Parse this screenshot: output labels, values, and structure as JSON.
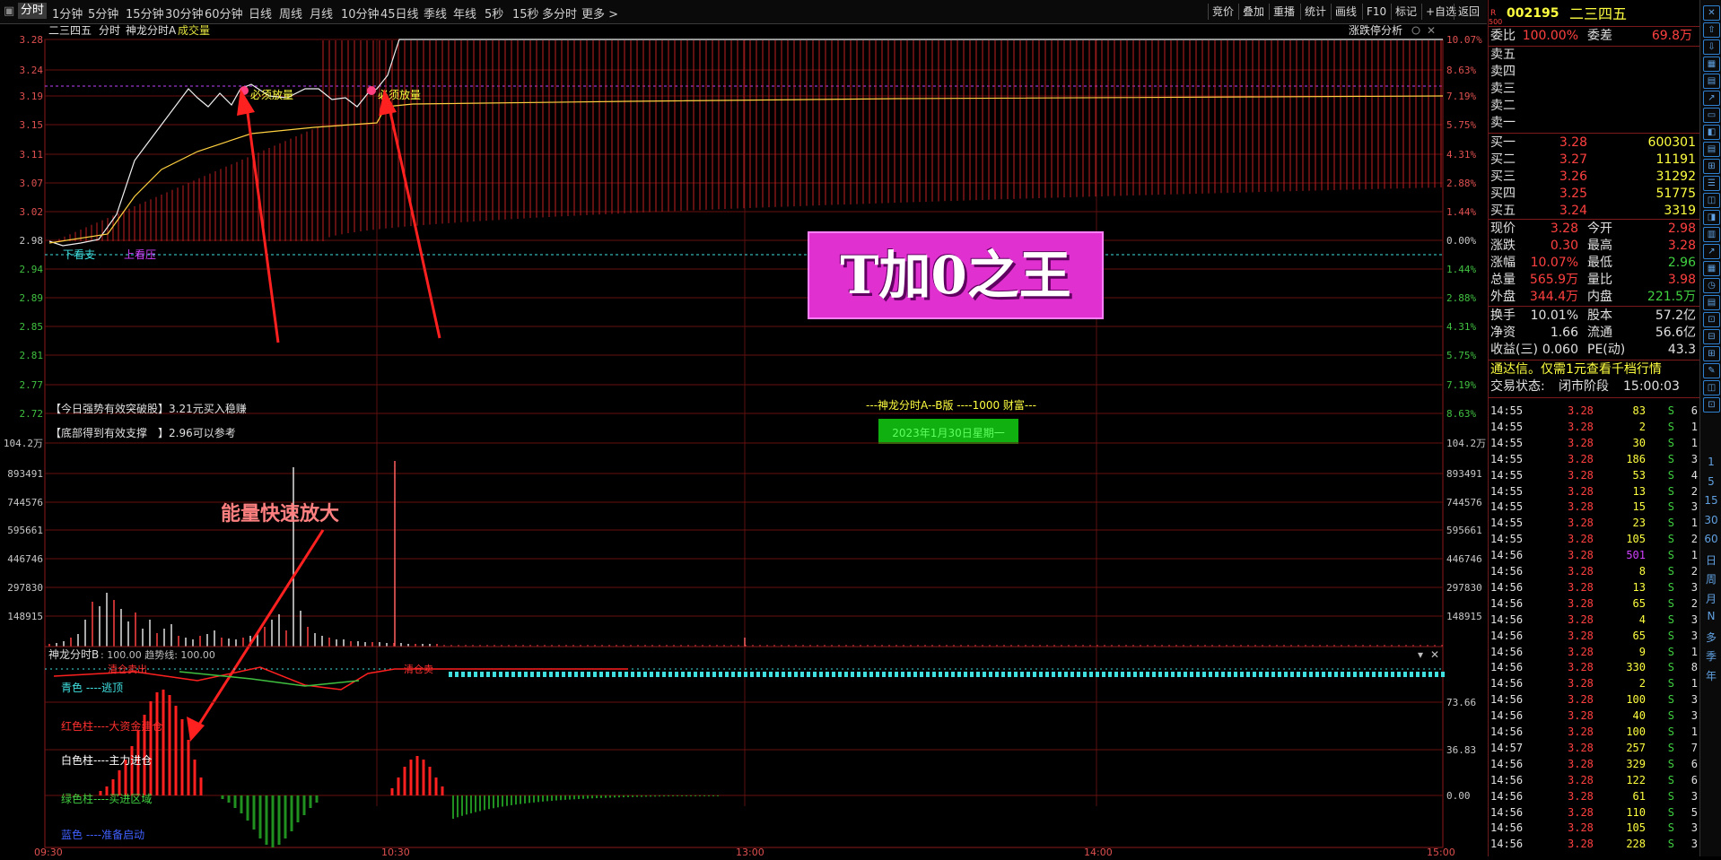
{
  "toolbar": {
    "tabs": [
      "分时",
      "1分钟",
      "5分钟",
      "15分钟",
      "30分钟",
      "60分钟",
      "日线",
      "周线",
      "月线",
      "10分钟",
      "45日线",
      "季线",
      "年线",
      "5秒",
      "15秒",
      "多分时",
      "更多 >"
    ],
    "right_buttons": [
      "竞价",
      "叠加",
      "重播",
      "统计",
      "画线",
      "F10",
      "标记",
      "+自选",
      "返回"
    ]
  },
  "chart": {
    "title_stock": "二三四五",
    "title_period": "分时",
    "title_indicator": "神龙分时A",
    "title_volume": "成交量",
    "analysis_button": "涨跌停分析",
    "price_ticks": [
      "3.28",
      "3.24",
      "3.19",
      "3.15",
      "3.11",
      "3.07",
      "3.02",
      "2.98",
      "2.94",
      "2.89",
      "2.85",
      "2.81",
      "2.77",
      "2.72"
    ],
    "pct_ticks": [
      "10.07%",
      "8.63%",
      "7.19%",
      "5.75%",
      "4.31%",
      "2.88%",
      "1.44%",
      "0.00%",
      "1.44%",
      "2.88%",
      "4.31%",
      "5.75%",
      "7.19%",
      "8.63%"
    ],
    "volume_ticks": [
      "104.2万",
      "893491",
      "744576",
      "595661",
      "446746",
      "297830",
      "148915"
    ],
    "signal_1": "必须放量",
    "signal_2": "必须放量",
    "label_lower_1": "下看支",
    "label_lower_2": "上看压",
    "note_1": "【今日强势有效突破股】3.21元买入稳赚",
    "note_2": "【底部得到有效支撑　】2.96可以参考",
    "center_title": "---神龙分时A--B版 ----1000 财富---",
    "green_box_text": "2023年1月30日星期一",
    "banner": "T加0之王",
    "annotation": "能量快速放大",
    "sub_title": "神龙分时B",
    "sub_values": ": 100.00  趋势线: 100.00",
    "sub_ticks": [
      "73.66",
      "36.83",
      "0.00"
    ],
    "legend": [
      {
        "text": "青色 ----逃顶",
        "color": "#40e0e0"
      },
      {
        "text": "红色柱----大资金建仓",
        "color": "#ff3030"
      },
      {
        "text": "白色柱----主力进仓",
        "color": "#ffffff"
      },
      {
        "text": "绿色柱----买进区域",
        "color": "#40d040"
      },
      {
        "text": "蓝色 ----准备启动",
        "color": "#4060ff"
      }
    ],
    "sub_marks": [
      "清仓卖出",
      "清仓卖"
    ],
    "time_axis": [
      "09:30",
      "10:30",
      "13:00",
      "14:00",
      "15:00"
    ]
  },
  "quote": {
    "code": "002195",
    "name": "二三四五",
    "r_label": "R",
    "r_sub": "500",
    "weibi_label": "委比",
    "weibi": "100.00%",
    "weicha_label": "委差",
    "weicha": "69.8万",
    "sells": [
      "卖五",
      "卖四",
      "卖三",
      "卖二",
      "卖一"
    ],
    "buys": [
      {
        "label": "买一",
        "price": "3.28",
        "vol": "600301"
      },
      {
        "label": "买二",
        "price": "3.27",
        "vol": "11191"
      },
      {
        "label": "买三",
        "price": "3.26",
        "vol": "31292"
      },
      {
        "label": "买四",
        "price": "3.25",
        "vol": "51775"
      },
      {
        "label": "买五",
        "price": "3.24",
        "vol": "3319"
      }
    ],
    "stats": [
      [
        "现价",
        "3.28",
        "今开",
        "2.98"
      ],
      [
        "涨跌",
        "0.30",
        "最高",
        "3.28"
      ],
      [
        "涨幅",
        "10.07%",
        "最低",
        "2.96"
      ],
      [
        "总量",
        "565.9万",
        "量比",
        "3.98"
      ],
      [
        "外盘",
        "344.4万",
        "内盘",
        "221.5万"
      ]
    ],
    "stats2": [
      [
        "换手",
        "10.01%",
        "股本",
        "57.2亿"
      ],
      [
        "净资",
        "1.66",
        "流通",
        "56.6亿"
      ],
      [
        "收益(三)",
        "0.060",
        "PE(动)",
        "43.3"
      ]
    ],
    "promo": "通达信。仅需1元查看千档行情",
    "status_label": "交易状态:",
    "status": "闭市阶段",
    "status_time": "15:00:03",
    "ticks": [
      [
        "14:55",
        "3.28",
        "83",
        "S",
        "6"
      ],
      [
        "14:55",
        "3.28",
        "2",
        "S",
        "1"
      ],
      [
        "14:55",
        "3.28",
        "30",
        "S",
        "1"
      ],
      [
        "14:55",
        "3.28",
        "186",
        "S",
        "3"
      ],
      [
        "14:55",
        "3.28",
        "53",
        "S",
        "4"
      ],
      [
        "14:55",
        "3.28",
        "13",
        "S",
        "2"
      ],
      [
        "14:55",
        "3.28",
        "15",
        "S",
        "3"
      ],
      [
        "14:55",
        "3.28",
        "23",
        "S",
        "1"
      ],
      [
        "14:55",
        "3.28",
        "105",
        "S",
        "2"
      ],
      [
        "14:56",
        "3.28",
        "501",
        "S",
        "1"
      ],
      [
        "14:56",
        "3.28",
        "8",
        "S",
        "2"
      ],
      [
        "14:56",
        "3.28",
        "13",
        "S",
        "3"
      ],
      [
        "14:56",
        "3.28",
        "65",
        "S",
        "2"
      ],
      [
        "14:56",
        "3.28",
        "4",
        "S",
        "3"
      ],
      [
        "14:56",
        "3.28",
        "65",
        "S",
        "3"
      ],
      [
        "14:56",
        "3.28",
        "9",
        "S",
        "1"
      ],
      [
        "14:56",
        "3.28",
        "330",
        "S",
        "8"
      ],
      [
        "14:56",
        "3.28",
        "2",
        "S",
        "1"
      ],
      [
        "14:56",
        "3.28",
        "100",
        "S",
        "3"
      ],
      [
        "14:56",
        "3.28",
        "40",
        "S",
        "3"
      ],
      [
        "14:56",
        "3.28",
        "100",
        "S",
        "1"
      ],
      [
        "14:57",
        "3.28",
        "257",
        "S",
        "7"
      ],
      [
        "14:56",
        "3.28",
        "329",
        "S",
        "6"
      ],
      [
        "14:56",
        "3.28",
        "122",
        "S",
        "6"
      ],
      [
        "14:56",
        "3.28",
        "61",
        "S",
        "3"
      ],
      [
        "14:56",
        "3.28",
        "110",
        "S",
        "5"
      ],
      [
        "14:56",
        "3.28",
        "105",
        "S",
        "3"
      ],
      [
        "14:56",
        "3.28",
        "228",
        "S",
        "3"
      ]
    ]
  },
  "side_icons": [
    "1",
    "5",
    "15",
    "30",
    "60",
    "日",
    "周",
    "月",
    "N",
    "多",
    "季",
    "年"
  ],
  "colors": {
    "red": "#ff4040",
    "green": "#40d040",
    "yellow": "#ffff40",
    "bg": "#000000"
  }
}
